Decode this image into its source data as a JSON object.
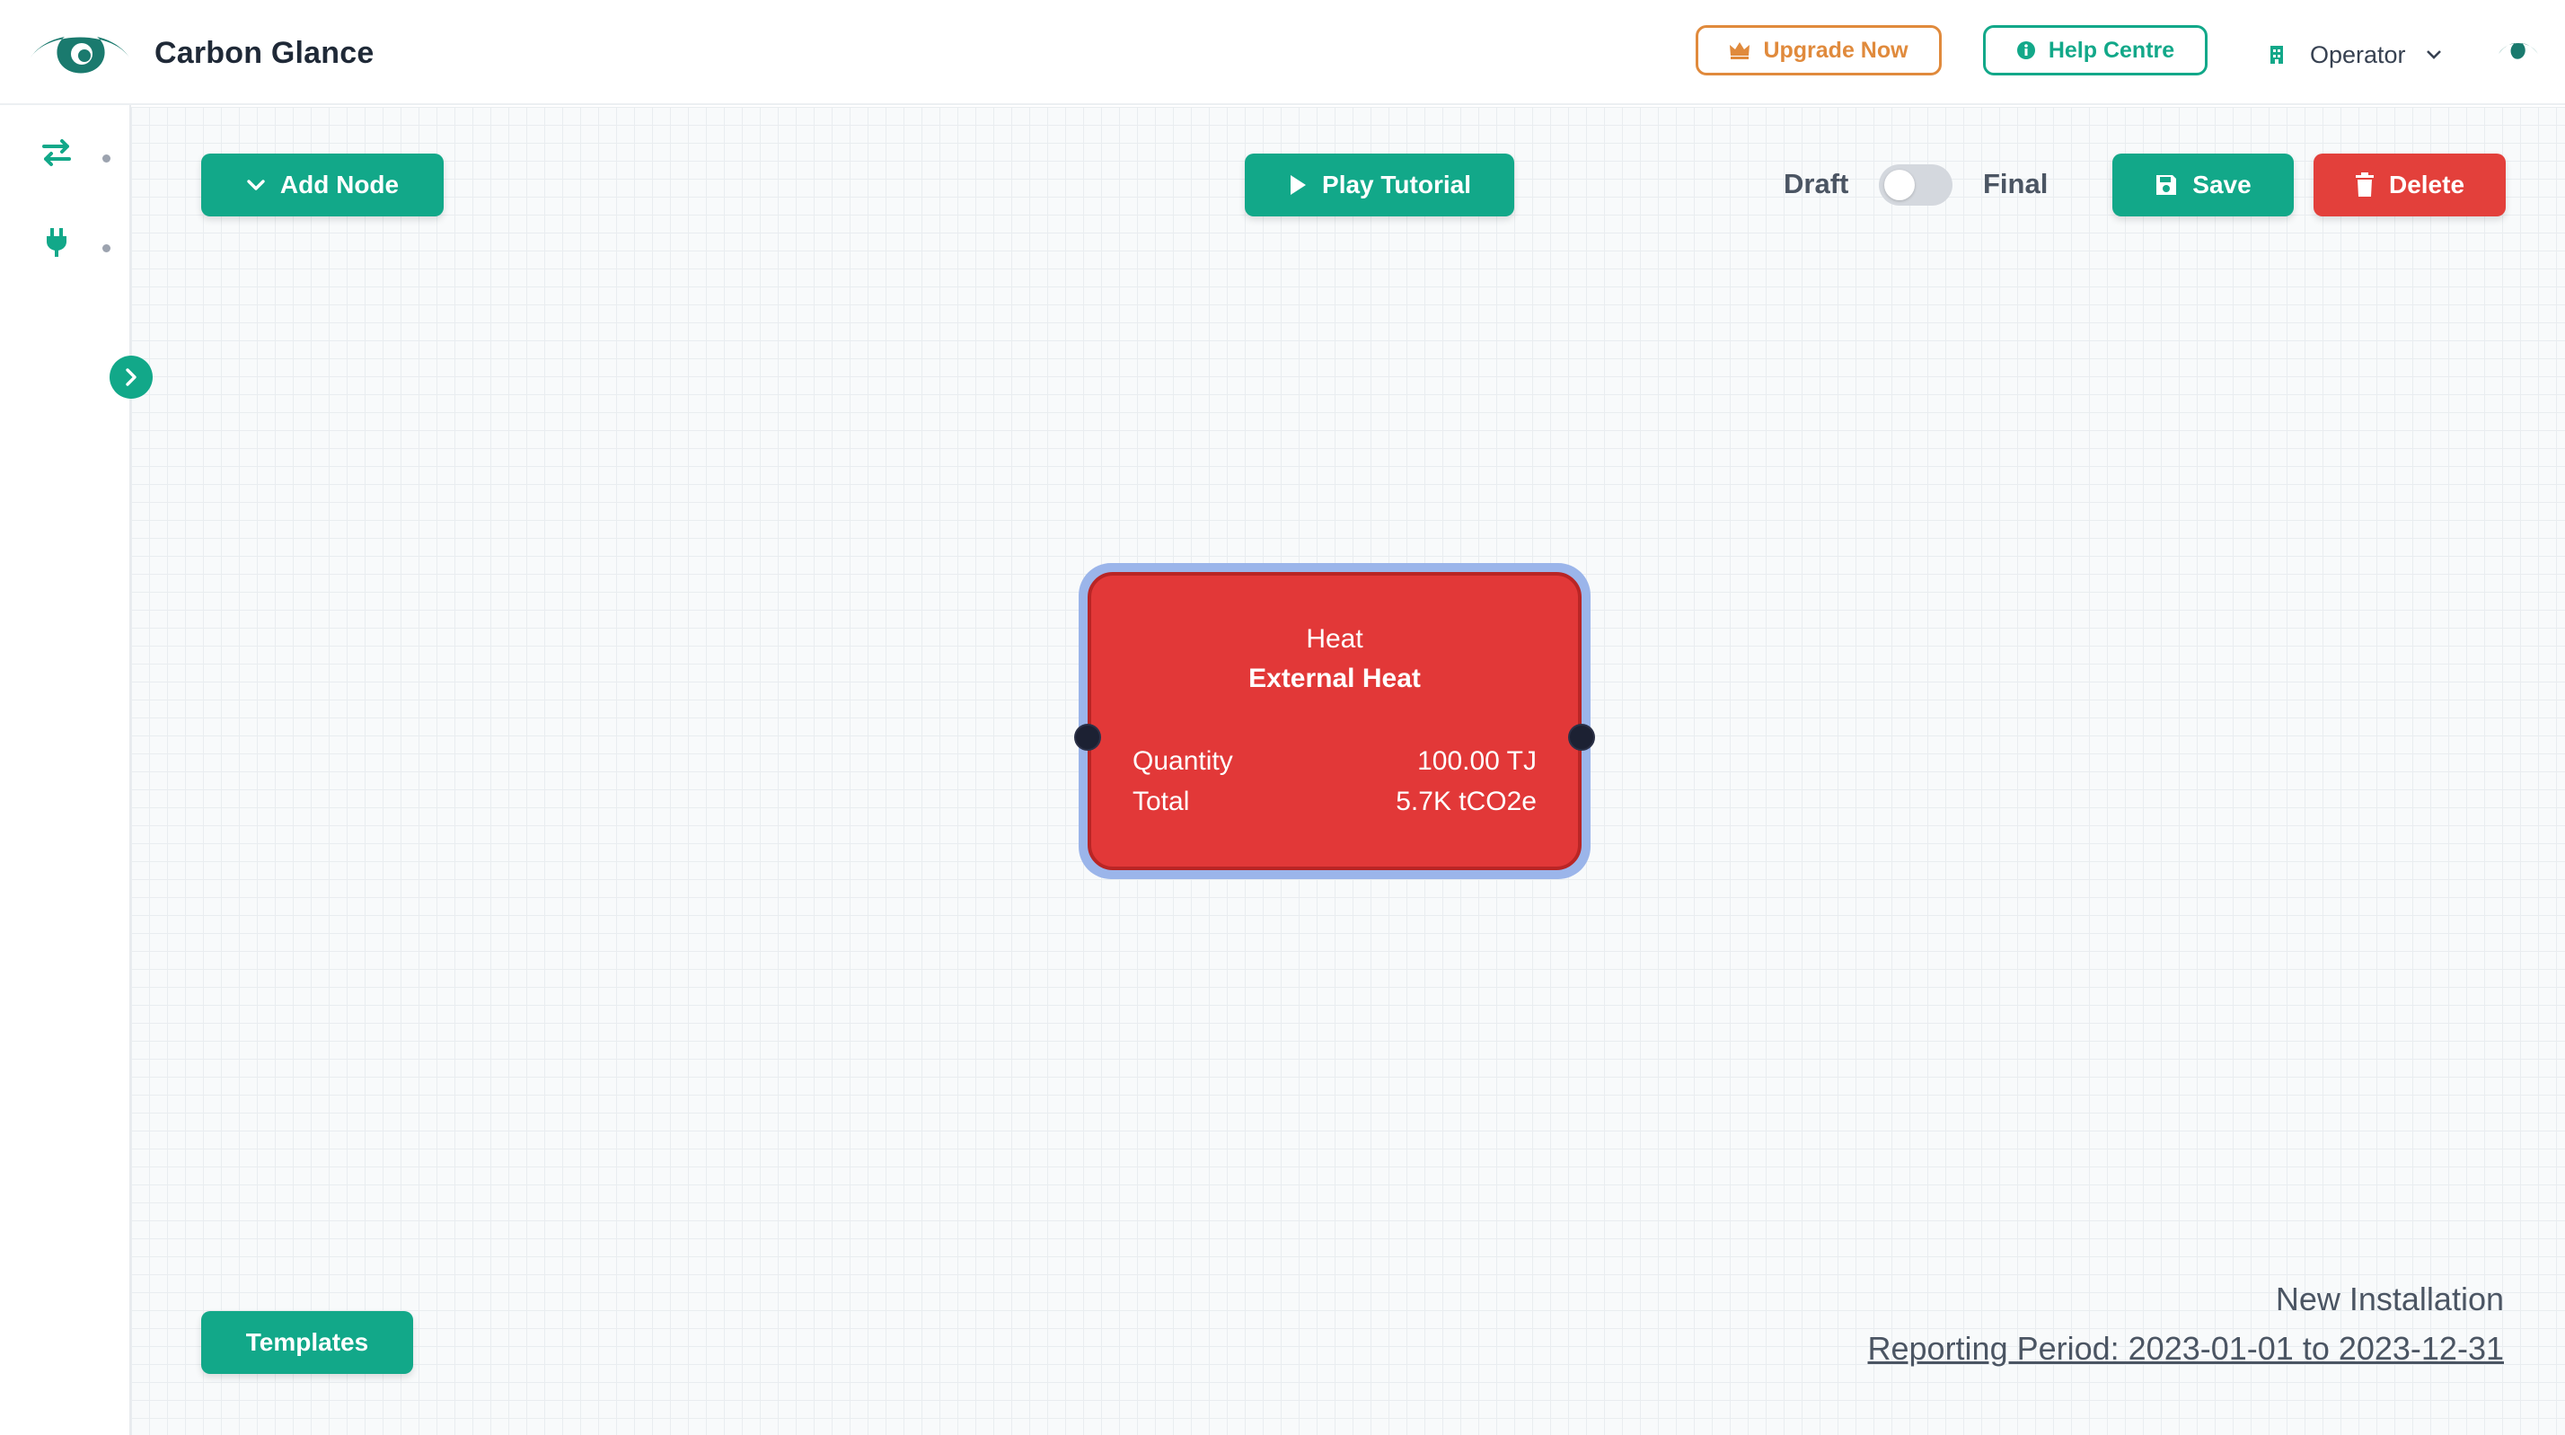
{
  "brand": {
    "name": "Carbon Glance",
    "logo_icon": "eye-logo-icon"
  },
  "header": {
    "upgrade_label": "Upgrade Now",
    "help_label": "Help Centre",
    "role": "Operator"
  },
  "sidebar": {
    "items": [
      {
        "icon": "swap-arrows-icon"
      },
      {
        "icon": "plug-icon"
      }
    ],
    "expand_icon": "chevron-right-icon"
  },
  "toolbar": {
    "add_node_label": "Add Node",
    "play_tutorial_label": "Play Tutorial",
    "draft_label": "Draft",
    "final_label": "Final",
    "status_final": false,
    "save_label": "Save",
    "delete_label": "Delete",
    "templates_label": "Templates"
  },
  "node": {
    "category": "Heat",
    "title": "External Heat",
    "rows": [
      {
        "label": "Quantity",
        "value": "100.00 TJ"
      },
      {
        "label": "Total",
        "value": "5.7K tCO2e"
      }
    ]
  },
  "installation": {
    "name": "New Installation",
    "reporting_period": "Reporting Period: 2023-01-01 to 2023-12-31"
  },
  "colors": {
    "primary": "#12a889",
    "danger": "#e3403b",
    "upgrade": "#e08a3c",
    "node_fill": "#e23838",
    "node_selection": "#9bb5ea",
    "brand_dark": "#1a7a6e"
  }
}
